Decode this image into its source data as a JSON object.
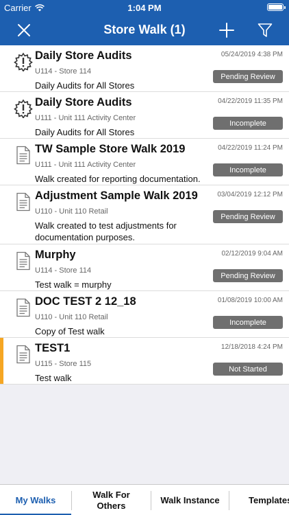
{
  "status_bar": {
    "carrier": "Carrier",
    "time": "1:04 PM"
  },
  "nav": {
    "title": "Store Walk (1)",
    "close_icon": "close-icon",
    "add_icon": "plus-icon",
    "filter_icon": "filter-icon"
  },
  "colors": {
    "brand": "#1d5fb0",
    "status_button": "#6f6f6f",
    "accent": "#f5a623"
  },
  "walks": [
    {
      "title": "Daily Store Audits",
      "date": "05/24/2019 4:38 PM",
      "store": "U114 - Store 114",
      "description": "Daily Audits for All Stores",
      "status": "Pending Review",
      "icon": "alert-gear-icon"
    },
    {
      "title": "Daily Store Audits",
      "date": "04/22/2019 11:35 PM",
      "store": "U111 - Unit 111 Activity Center",
      "description": "Daily Audits for All Stores",
      "status": "Incomplete",
      "icon": "alert-gear-icon"
    },
    {
      "title": "TW Sample Store Walk 2019",
      "date": "04/22/2019 11:24 PM",
      "store": "U111 - Unit 111 Activity Center",
      "description": "Walk created for reporting documentation.",
      "status": "Incomplete",
      "icon": "document-icon"
    },
    {
      "title": "Adjustment Sample Walk 2019",
      "date": "03/04/2019 12:12 PM",
      "store": "U110 - Unit 110 Retail",
      "description": "Walk created to test adjustments for documentation purposes.",
      "status": "Pending Review",
      "icon": "document-icon"
    },
    {
      "title": "Murphy",
      "date": "02/12/2019 9:04 AM",
      "store": "U114 - Store 114",
      "description": "Test walk = murphy",
      "status": "Pending Review",
      "icon": "document-icon"
    },
    {
      "title": "DOC TEST 2 12_18",
      "date": "01/08/2019 10:00 AM",
      "store": "U110 - Unit 110 Retail",
      "description": "Copy of Test walk",
      "status": "Incomplete",
      "icon": "document-icon"
    },
    {
      "title": "TEST1",
      "date": "12/18/2018 4:24 PM",
      "store": "U115 - Store 115",
      "description": "Test walk",
      "status": "Not Started",
      "icon": "document-icon"
    }
  ],
  "tabs": [
    {
      "label": "My Walks"
    },
    {
      "label": "Walk For Others"
    },
    {
      "label": "Walk Instance"
    },
    {
      "label": "Templates"
    }
  ]
}
